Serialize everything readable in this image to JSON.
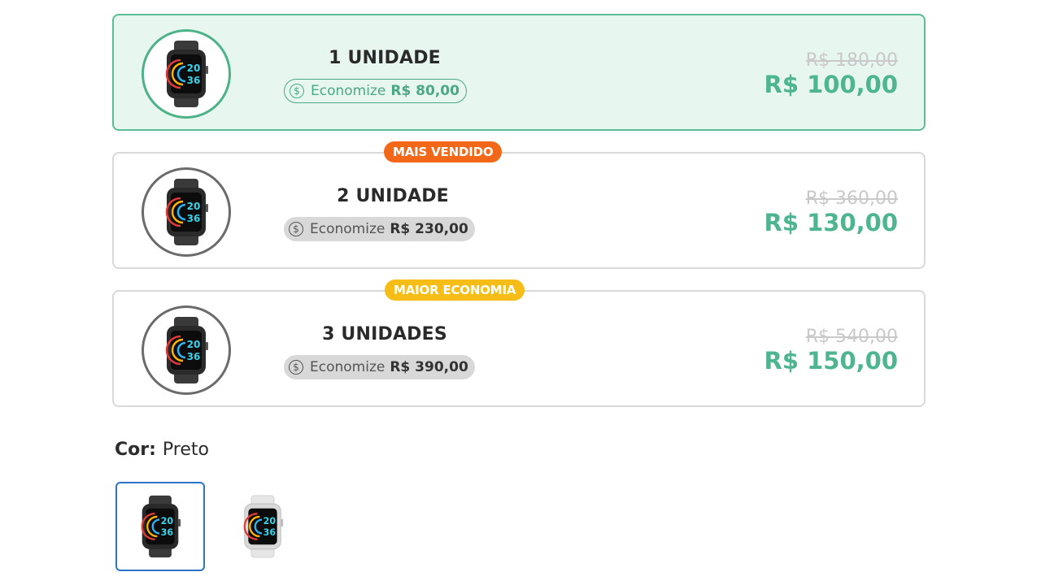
{
  "offers": [
    {
      "quantity": "1 UNIDADE",
      "save_prefix": "Economize",
      "save_amount": "R$ 80,00",
      "old_price": "R$ 180,00",
      "price": "R$ 100,00",
      "badge": "",
      "selected": true
    },
    {
      "quantity": "2 UNIDADE",
      "save_prefix": "Economize",
      "save_amount": "R$ 230,00",
      "old_price": "R$ 360,00",
      "price": "R$ 130,00",
      "badge": "MAIS VENDIDO",
      "selected": false
    },
    {
      "quantity": "3 UNIDADES",
      "save_prefix": "Economize",
      "save_amount": "R$ 390,00",
      "old_price": "R$ 540,00",
      "price": "R$ 150,00",
      "badge": "MAIOR ECONOMIA",
      "selected": false
    }
  ],
  "watch_face": {
    "hour": "20",
    "minute": "36"
  },
  "color_option": {
    "label": "Cor:",
    "value": "Preto",
    "swatches": [
      {
        "name": "Preto",
        "selected": true
      },
      {
        "name": "Branco",
        "selected": false
      }
    ]
  },
  "colors": {
    "accent_green": "#4db58f",
    "selected_bg": "#e8f6f0",
    "badge_orange": "#f26718",
    "badge_yellow": "#f6bd16",
    "swatch_border": "#2b74c7"
  },
  "icons": {
    "savings": "dollar-coin-icon",
    "product": "smartwatch-icon"
  }
}
